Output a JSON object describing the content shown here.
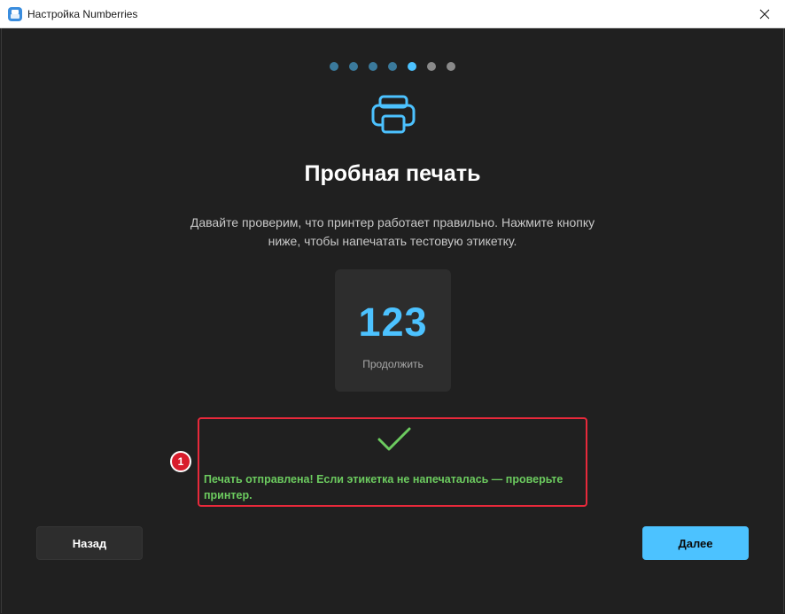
{
  "window": {
    "title": "Настройка Numberries",
    "app_icon": "printer-app-icon",
    "close_icon": "close-icon"
  },
  "progress": {
    "total_steps": 7,
    "current_step": 5,
    "colors": {
      "completed": "#3b7a9c",
      "active": "#4cc2ff",
      "upcoming": "#8a8a8a"
    }
  },
  "main": {
    "icon": "printer-icon",
    "title": "Пробная печать",
    "description": "Давайте проверим, что принтер работает правильно. Нажмите кнопку ниже, чтобы напечатать тестовую этикетку."
  },
  "test_label": {
    "number": "123",
    "caption": "Продолжить"
  },
  "status": {
    "icon": "checkmark-icon",
    "message": "Печать отправлена! Если этикетка не напечаталась — проверьте принтер.",
    "color": "#6ccb5f"
  },
  "annotation": {
    "badge": "1",
    "color": "#e8293b"
  },
  "buttons": {
    "back_label": "Назад",
    "next_label": "Далее",
    "accent": "#4cc2ff"
  }
}
